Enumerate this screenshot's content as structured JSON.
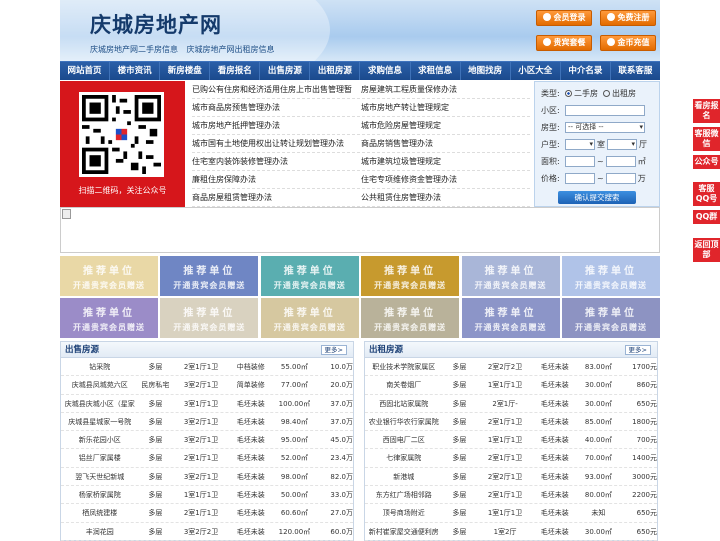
{
  "header": {
    "site_title": "庆城房地产网",
    "sub_links": [
      "庆城房地产网二手房信息",
      "庆城房地产网出租房信息"
    ],
    "buttons": [
      "会员登录",
      "免费注册",
      "贵宾套餐",
      "金币充值"
    ]
  },
  "nav": [
    "网站首页",
    "楼市资讯",
    "新房楼盘",
    "看房报名",
    "出售房源",
    "出租房源",
    "求购信息",
    "求租信息",
    "地图找房",
    "小区大全",
    "中介名录",
    "联系客服"
  ],
  "qr": {
    "caption": "扫描二维码，关注公众号"
  },
  "links": [
    [
      "已购公有住房和经济适用住房上市出售管理暂",
      "房屋建筑工程质量保修办法"
    ],
    [
      "城市商品房预售管理办法",
      "城市房地产转让管理规定"
    ],
    [
      "城市房地产抵押管理办法",
      "城市危险房屋管理规定"
    ],
    [
      "城市国有土地使用权出让转让规划管理办法",
      "商品房销售管理办法"
    ],
    [
      "住宅室内装饰装修管理办法",
      "城市建筑垃圾管理规定"
    ],
    [
      "廉租住房保障办法",
      "住宅专项维修资金管理办法"
    ],
    [
      "商品房屋租赁管理办法",
      "公共租赁住房管理办法"
    ]
  ],
  "search": {
    "type_label": "类型:",
    "type_options": [
      "二手房",
      "出租房"
    ],
    "community_label": "小区:",
    "house_type_label": "房型:",
    "house_type_value": "-- 可选择 --",
    "layout_label": "户型:",
    "room_unit": "室",
    "hall_unit": "厅",
    "area_label": "面积:",
    "area_unit": "㎡",
    "range_sep": "~",
    "price_label": "价格:",
    "price_unit": "万",
    "submit": "确认提交搜索"
  },
  "recommend": {
    "title": "推荐单位",
    "subtitle": "开通贵宾会员赠送",
    "colors": [
      "#e9d8a6",
      "#6f86c4",
      "#5aaeb0",
      "#c79a2e",
      "#a9b6d8",
      "#b0c3e8",
      "#9b8cc8",
      "#d9d2c0",
      "#d6c8a0",
      "#b9b29a",
      "#8c95c8",
      "#8d93c2"
    ]
  },
  "sale": {
    "title": "出售房源",
    "more": "更多>",
    "rows": [
      [
        "钻采院",
        "多层",
        "2室1厅1卫",
        "中档装修",
        "55.00㎡",
        "10.0万"
      ],
      [
        "庆城县凤城苑六区",
        "民房私宅",
        "3室2厅1卫",
        "简单装修",
        "77.00㎡",
        "20.0万"
      ],
      [
        "庆城县庆城小区（星家",
        "多层",
        "3室1厅1卫",
        "毛坯未装",
        "100.00㎡",
        "37.0万"
      ],
      [
        "庆城县星城家一号院",
        "多层",
        "3室2厅1卫",
        "毛坯未装",
        "98.40㎡",
        "37.0万"
      ],
      [
        "新乐花园小区",
        "多层",
        "3室2厅1卫",
        "毛坯未装",
        "95.00㎡",
        "45.0万"
      ],
      [
        "铝丝厂家属楼",
        "多层",
        "2室1厅1卫",
        "毛坯未装",
        "52.00㎡",
        "23.4万"
      ],
      [
        "翌飞天世纪新城",
        "多层",
        "3室2厅1卫",
        "毛坯未装",
        "98.00㎡",
        "82.0万"
      ],
      [
        "杨家桥家属院",
        "多层",
        "1室1厅1卫",
        "毛坯未装",
        "50.00㎡",
        "33.0万"
      ],
      [
        "栖凤统建楼",
        "多层",
        "2室1厅1卫",
        "毛坯未装",
        "60.60㎡",
        "27.0万"
      ],
      [
        "丰润花园",
        "多层",
        "3室2厅2卫",
        "毛坯未装",
        "120.00㎡",
        "60.0万"
      ]
    ]
  },
  "rent": {
    "title": "出租房源",
    "more": "更多>",
    "rows": [
      [
        "职业技术学院家属区",
        "多层",
        "2室2厅2卫",
        "毛坯未装",
        "83.00㎡",
        "1700元"
      ],
      [
        "南关卷烟厂",
        "多层",
        "1室1厅1卫",
        "毛坯未装",
        "30.00㎡",
        "860元"
      ],
      [
        "西固北站家属院",
        "多层",
        "2室1厅-",
        "毛坯未装",
        "30.00㎡",
        "650元"
      ],
      [
        "农业银行华农行家属院",
        "多层",
        "2室1厅1卫",
        "毛坯未装",
        "85.00㎡",
        "1800元"
      ],
      [
        "西固电厂二区",
        "多层",
        "1室1厅1卫",
        "毛坯未装",
        "40.00㎡",
        "700元"
      ],
      [
        "七律家属院",
        "多层",
        "2室1厅1卫",
        "毛坯未装",
        "70.00㎡",
        "1400元"
      ],
      [
        "新港城",
        "多层",
        "2室2厅1卫",
        "毛坯未装",
        "93.00㎡",
        "3000元"
      ],
      [
        "东方红广场相邻路",
        "多层",
        "2室1厅1卫",
        "毛坯未装",
        "80.00㎡",
        "2200元"
      ],
      [
        "顶号商场附近",
        "多层",
        "1室1厅1卫",
        "毛坯未装",
        "未知",
        "650元"
      ],
      [
        "新村崔家屋交通便利房",
        "多层",
        "1室2厅",
        "毛坯未装",
        "30.00㎡",
        "650元"
      ]
    ]
  },
  "float": [
    "看房报名",
    "客服微信",
    "公众号",
    "客服QQ号",
    "QQ群",
    "返回顶部"
  ]
}
